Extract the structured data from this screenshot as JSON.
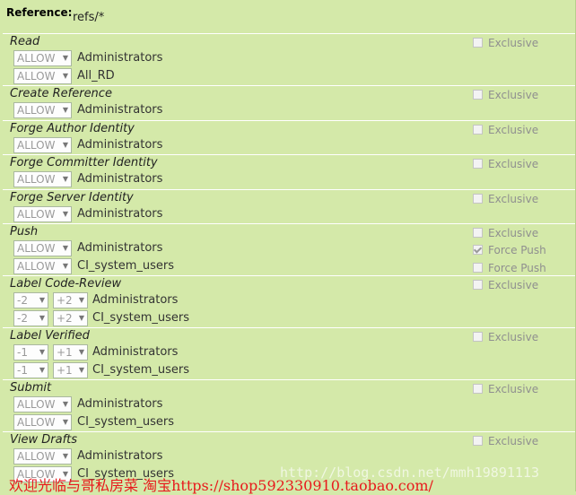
{
  "reference": {
    "label": "Reference:",
    "value": "refs/*"
  },
  "exclusive_label": "Exclusive",
  "sections": [
    {
      "title": "Read",
      "rows": [
        {
          "kind": "action",
          "action": "ALLOW",
          "group": "Administrators"
        },
        {
          "kind": "action",
          "action": "ALLOW",
          "group": "All_RD"
        }
      ]
    },
    {
      "title": "Create Reference",
      "rows": [
        {
          "kind": "action",
          "action": "ALLOW",
          "group": "Administrators"
        }
      ]
    },
    {
      "title": "Forge Author Identity",
      "rows": [
        {
          "kind": "action",
          "action": "ALLOW",
          "group": "Administrators"
        }
      ]
    },
    {
      "title": "Forge Committer Identity",
      "rows": [
        {
          "kind": "action",
          "action": "ALLOW",
          "group": "Administrators"
        }
      ]
    },
    {
      "title": "Forge Server Identity",
      "rows": [
        {
          "kind": "action",
          "action": "ALLOW",
          "group": "Administrators"
        }
      ]
    },
    {
      "title": "Push",
      "rows": [
        {
          "kind": "action",
          "action": "ALLOW",
          "group": "Administrators",
          "option": {
            "label": "Force Push",
            "checked": true
          }
        },
        {
          "kind": "action",
          "action": "ALLOW",
          "group": "CI_system_users",
          "option": {
            "label": "Force Push",
            "checked": false
          }
        }
      ]
    },
    {
      "title": "Label Code-Review",
      "rows": [
        {
          "kind": "range",
          "min": "-2",
          "max": "+2",
          "group": "Administrators"
        },
        {
          "kind": "range",
          "min": "-2",
          "max": "+2",
          "group": "CI_system_users"
        }
      ]
    },
    {
      "title": "Label Verified",
      "rows": [
        {
          "kind": "range",
          "min": "-1",
          "max": "+1",
          "group": "Administrators"
        },
        {
          "kind": "range",
          "min": "-1",
          "max": "+1",
          "group": "CI_system_users"
        }
      ]
    },
    {
      "title": "Submit",
      "rows": [
        {
          "kind": "action",
          "action": "ALLOW",
          "group": "Administrators"
        },
        {
          "kind": "action",
          "action": "ALLOW",
          "group": "CI_system_users"
        }
      ]
    },
    {
      "title": "View Drafts",
      "rows": [
        {
          "kind": "action",
          "action": "ALLOW",
          "group": "Administrators"
        },
        {
          "kind": "action",
          "action": "ALLOW",
          "group": "CI_system_users"
        }
      ]
    }
  ],
  "watermarks": {
    "blog": "http://blog.csdn.net/mmh19891113",
    "shop": "欢迎光临与哥私房菜 淘宝https://shop592330910.taobao.com/"
  },
  "colors": {
    "background": "#d4e9a9",
    "divider": "#ffffff",
    "watermark_red": "#e8191c"
  }
}
